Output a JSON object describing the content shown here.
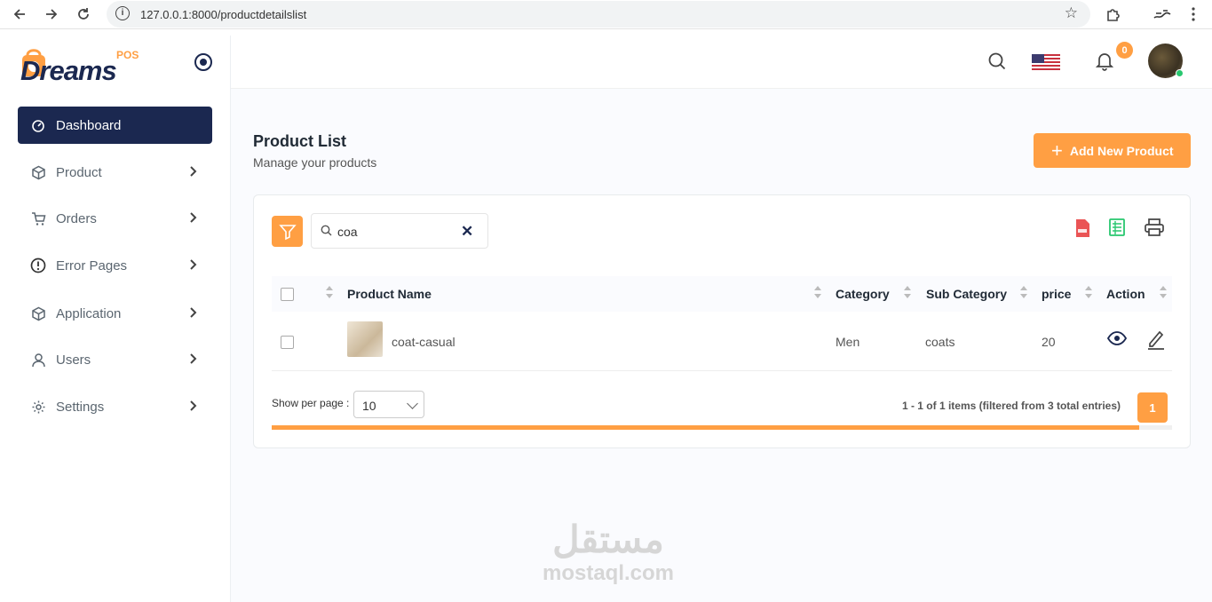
{
  "browser": {
    "url": "127.0.0.1:8000/productdetailslist"
  },
  "sidebar": {
    "logo_word": "Dreams",
    "logo_pos": "POS",
    "items": [
      {
        "label": "Dashboard",
        "icon": "gauge-icon",
        "active": true
      },
      {
        "label": "Product",
        "icon": "box-icon"
      },
      {
        "label": "Orders",
        "icon": "cart-icon"
      },
      {
        "label": "Error Pages",
        "icon": "alert-circle-icon"
      },
      {
        "label": "Application",
        "icon": "box-icon"
      },
      {
        "label": "Users",
        "icon": "user-icon"
      },
      {
        "label": "Settings",
        "icon": "gear-icon"
      }
    ]
  },
  "topbar": {
    "notification_count": "0"
  },
  "page": {
    "title": "Product List",
    "subtitle": "Manage your products",
    "add_button": "Add New Product"
  },
  "search": {
    "value": "coa"
  },
  "table": {
    "headers": [
      "Product Name",
      "Category",
      "Sub Category",
      "price",
      "Action"
    ],
    "rows": [
      {
        "name": "coat-casual",
        "category": "Men",
        "sub_category": "coats",
        "price": "20"
      }
    ]
  },
  "footer": {
    "per_page_label": "Show per page :",
    "per_page_value": "10",
    "info": "1 - 1 of 1 items (filtered from 3 total entries)",
    "current_page": "1"
  },
  "watermark": {
    "arabic": "مستقل",
    "latin": "mostaql.com"
  },
  "colors": {
    "accent": "#ff9f43",
    "navy": "#1b2850",
    "pdf_red": "#ea5455",
    "excel_green": "#28c76f"
  }
}
